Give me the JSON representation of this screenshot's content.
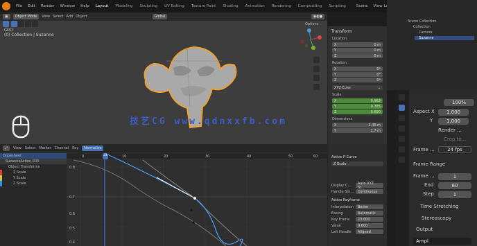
{
  "topbar": {
    "menus": [
      "File",
      "Edit",
      "Render",
      "Window",
      "Help"
    ],
    "workspaces": [
      "Layout",
      "Modeling",
      "Sculpting",
      "UV Editing",
      "Texture Paint",
      "Shading",
      "Animation",
      "Rendering",
      "Compositing",
      "Scripting"
    ],
    "active": "Layout",
    "scene": "Scene",
    "view_layer": "View Layer"
  },
  "viewport": {
    "mode": "Object Mode",
    "menus": [
      "View",
      "Select",
      "Add",
      "Object"
    ],
    "orientation": "Global",
    "frame_label": "(24)",
    "collection": "(0) Collection | Suzanne",
    "options": "Options"
  },
  "npanel": {
    "title": "Transform",
    "location": "Location",
    "x": "0 m",
    "y": "0 m",
    "z": "0 m",
    "rotation": "Rotation",
    "rx": "0°",
    "ry": "0°",
    "rz": "0°",
    "rot_mode": "XYZ Euler",
    "scale": "Scale",
    "sx": "0.963",
    "sy": "0.785",
    "sz": "0.690",
    "dimensions": "Dimensions",
    "dx": "2.46 m",
    "dy": "1.7 m"
  },
  "outliner": {
    "scene_collection": "Scene Collection",
    "collection": "Collection",
    "camera": "Camera",
    "suzanne": "Suzanne"
  },
  "props": {
    "aspect_label": "Aspect X",
    "aspect_x": "1.000",
    "aspect_y_label": "Y",
    "aspect_y": "1.000",
    "render_region": "Render ...",
    "crop": "Crop to...",
    "frame_rate_label": "Frame ...",
    "frame_rate": "24 fps",
    "frame_range": "Frame Range",
    "frame_start_label": "Frame ...",
    "frame_start": "1",
    "end_label": "End",
    "end": "60",
    "step_label": "Step",
    "step": "1",
    "time_stretching": "Time Stretching",
    "stereoscopy": "Stereoscopy",
    "output": "Output",
    "output_value": "Ampl",
    "percent": "100%"
  },
  "graph": {
    "menus": [
      "View",
      "Select",
      "Marker",
      "Channel",
      "Key"
    ],
    "normalize": "Normalize",
    "channels": [
      "Dopesheet",
      "SuzanneAction.003",
      "Object Transforms",
      "Z Scale",
      "Y Scale",
      "Z Scale"
    ],
    "frames": [
      "0",
      "10",
      "20",
      "30",
      "40",
      "50",
      "60",
      "70"
    ],
    "values": [
      "0.8",
      "0.7",
      "0.6",
      "0.5",
      "0.4"
    ],
    "current_frame": "24"
  },
  "fcurve": {
    "title": "Active F-Curve",
    "name": "Z Scale",
    "active_keyframe": "Active Keyframe",
    "interp_label": "Interpolation",
    "interp": "Bezier",
    "easing_label": "Easing",
    "easing": "Automatic",
    "keyframe_label": "Key Frame",
    "keyframe": "23.000",
    "value_label": "Value",
    "value": "0.600",
    "left_handle": "Left Handle",
    "left_value": "Aligned",
    "color_label": "Display C...",
    "color": "Auto XYZ to...",
    "handle_label": "Handle Sm...",
    "handle": "Continuous"
  },
  "watermark": "技艺CG www.qdnxxfb.com"
}
